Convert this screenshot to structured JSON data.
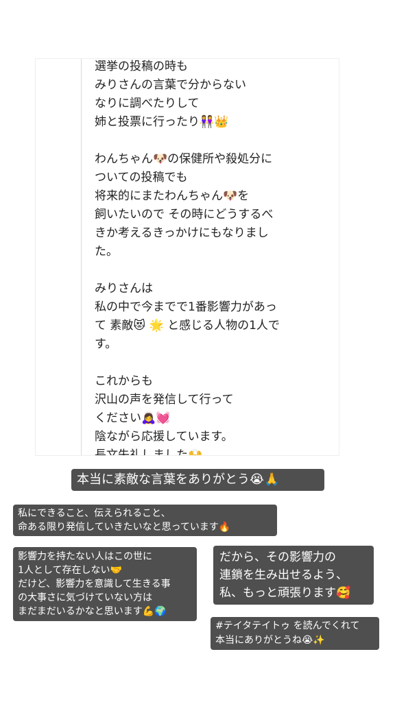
{
  "screenshot": {
    "message_lines": [
      "選挙の投稿の時も",
      "みりさんの言葉で分からない",
      "なりに調べたりして",
      "姉と投票に行ったり👭👑",
      "",
      "わんちゃん🐶の保健所や殺処分に",
      "ついての投稿でも",
      "将来的にまたわんちゃん🐶を",
      "飼いたいので その時にどうするべ",
      "きか考えるきっかけにもなりまし",
      "た。",
      "",
      "みりさんは",
      "私の中で今までで1番影響力があっ",
      "て 素敵😻 🌟 と感じる人物の1人で",
      "す。",
      "",
      "これからも",
      "沢山の声を発信して行って",
      "ください🙇‍♀️💓",
      "陰ながら応援しています。",
      "長文失礼しました🙌"
    ]
  },
  "captions": {
    "title": "本当に素敵な言葉をありがとう😭🙏",
    "block2": [
      "私にできること、伝えられること、",
      "命ある限り発信していきたいなと思っています🔥"
    ],
    "block3": [
      "影響力を持たない人はこの世に",
      "1人として存在しない🤝",
      "だけど、影響力を意識して生きる事",
      "の大事さに気づけていない方は",
      "まだまだいるかなと思います💪🌍"
    ],
    "block4": [
      "だから、その影響力の",
      "連鎖を生み出せるよう、",
      "私、もっと頑張ります🥰"
    ],
    "block5": [
      "#テイタテイトゥ を読んでくれて",
      "本当にありがとうね😭✨"
    ]
  }
}
